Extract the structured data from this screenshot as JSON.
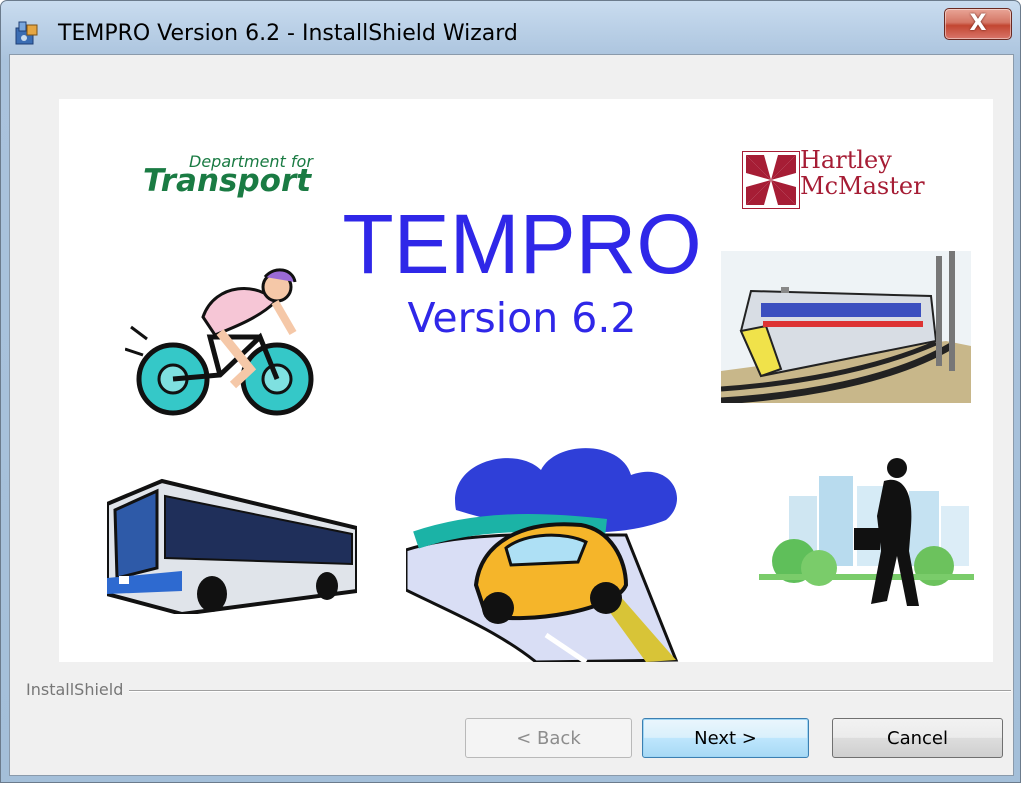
{
  "window": {
    "title": "TEMPRO Version 6.2 - InstallShield Wizard",
    "close_glyph": "X"
  },
  "banner": {
    "dft_line1": "Department for",
    "dft_line2": "Transport",
    "hm_line1": "Hartley",
    "hm_line2": "McMaster",
    "title": "TEMPRO",
    "version": "Version 6.2",
    "images": [
      "cyclist-clipart",
      "train-clipart",
      "bus-clipart",
      "car-clipart",
      "businessman-clipart"
    ]
  },
  "footer": {
    "brand": "InstallShield",
    "back_label": "< Back",
    "next_label": "Next >",
    "cancel_label": "Cancel"
  },
  "colors": {
    "title_blue": "#2f27e8",
    "dft_green": "#1a7b43",
    "hm_red": "#a61d35"
  }
}
